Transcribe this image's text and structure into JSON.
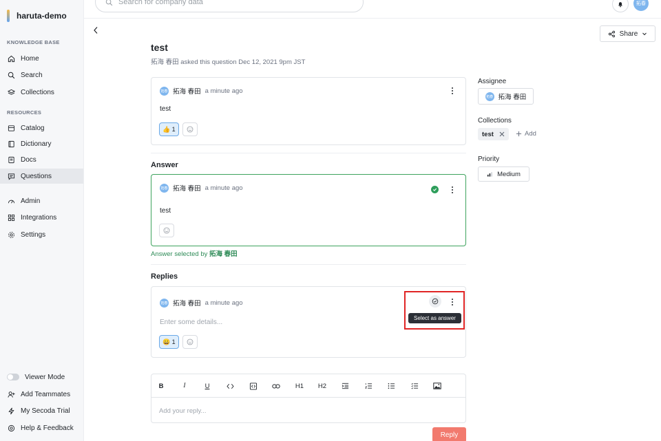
{
  "workspace": {
    "name": "haruta-demo"
  },
  "sidebar": {
    "knowledge_label": "KNOWLEDGE BASE",
    "resources_label": "RESOURCES",
    "items": [
      {
        "label": "Home",
        "icon": "home-icon"
      },
      {
        "label": "Search",
        "icon": "search-icon"
      },
      {
        "label": "Collections",
        "icon": "collections-icon"
      },
      {
        "label": "Catalog",
        "icon": "catalog-icon"
      },
      {
        "label": "Dictionary",
        "icon": "dictionary-icon"
      },
      {
        "label": "Docs",
        "icon": "docs-icon"
      },
      {
        "label": "Questions",
        "icon": "questions-icon",
        "active": true
      },
      {
        "label": "Admin",
        "icon": "admin-icon"
      },
      {
        "label": "Integrations",
        "icon": "integrations-icon"
      },
      {
        "label": "Settings",
        "icon": "settings-icon"
      }
    ],
    "bottom": [
      {
        "label": "Viewer Mode",
        "icon": "toggle"
      },
      {
        "label": "Add Teammates",
        "icon": "add-user-icon"
      },
      {
        "label": "My Secoda Trial",
        "icon": "lightning-icon"
      },
      {
        "label": "Help & Feedback",
        "icon": "help-icon"
      }
    ]
  },
  "topbar": {
    "search_placeholder": "Search for company data",
    "user_initials": "拓春"
  },
  "header": {
    "share_label": "Share"
  },
  "question": {
    "title": "test",
    "meta": "拓海 春田 asked this question Dec 12, 2021 9pm JST",
    "author": "拓海 春田",
    "time": "a minute ago",
    "body": "test",
    "reaction_emoji": "👍",
    "reaction_count": "1"
  },
  "answer": {
    "section_title": "Answer",
    "author": "拓海 春田",
    "time": "a minute ago",
    "body": "test",
    "selected_prefix": "Answer selected by ",
    "selected_by": "拓海 春田"
  },
  "replies": {
    "section_title": "Replies",
    "author": "拓海 春田",
    "time": "a minute ago",
    "placeholder": "Enter some details...",
    "reaction_emoji": "😀",
    "reaction_count": "1",
    "tooltip": "Select as answer"
  },
  "editor": {
    "toolbar": [
      "B",
      "I",
      "U",
      "H1",
      "H2"
    ],
    "placeholder": "Add your reply...",
    "reply_label": "Reply"
  },
  "right_panel": {
    "assignee_label": "Assignee",
    "assignee_name": "拓海 春田",
    "collections_label": "Collections",
    "collection_tag": "test",
    "add_label": "Add",
    "priority_label": "Priority",
    "priority_value": "Medium"
  },
  "avatar_initials": "拓春",
  "colors": {
    "accent_green": "#2e9e5b",
    "reply_button": "#f27a6e",
    "highlight": "#e02424"
  }
}
